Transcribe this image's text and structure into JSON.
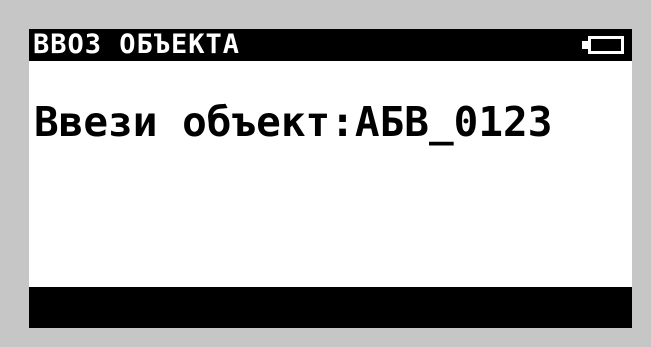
{
  "screen": {
    "title": "ВВОЗ ОБЪЕКТА",
    "battery_icon": "battery-icon",
    "prompt": {
      "label": "Ввези объект",
      "separator": ":",
      "value": "АБВ_0123"
    },
    "colors": {
      "frame": "#c6c6c6",
      "lcd_background": "#ffffff",
      "bars": "#000000",
      "text": "#000000"
    }
  }
}
